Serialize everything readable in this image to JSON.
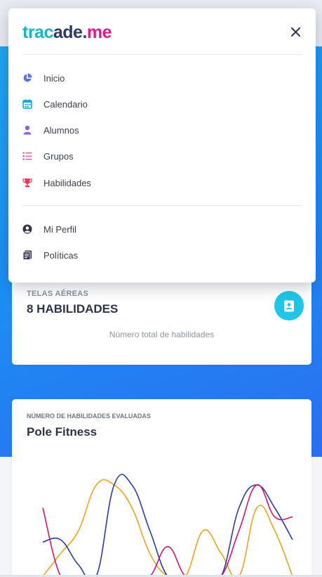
{
  "brand": {
    "logo_part1": "trac",
    "logo_part2": "ade.",
    "logo_part3": "me"
  },
  "menu": {
    "primary": [
      {
        "label": "Inicio",
        "icon": "pie-chart-icon",
        "color": "#5e72e4"
      },
      {
        "label": "Calendario",
        "icon": "calendar-icon",
        "color": "#11a8d8"
      },
      {
        "label": "Alumnos",
        "icon": "user-icon",
        "color": "#8965e0"
      },
      {
        "label": "Grupos",
        "icon": "list-icon",
        "color": "#f3449f"
      },
      {
        "label": "Habilidades",
        "icon": "trophy-icon",
        "color": "#f5365c"
      }
    ],
    "secondary": [
      {
        "label": "Mi Perfil",
        "icon": "user-circle-icon",
        "color": "#2e3447"
      },
      {
        "label": "Políticas",
        "icon": "document-icon",
        "color": "#2e3447"
      }
    ]
  },
  "cards": {
    "telas": {
      "category": "TELAS AÉREAS",
      "count": "8 HABILIDADES",
      "subtitle": "Número total de habilidades"
    },
    "pole": {
      "category": "NÚMERO DE HABILIDADES EVALUADAS",
      "title": "Pole Fitness"
    }
  },
  "colors": {
    "accent_cyan": "#1fc6e8",
    "gradient_start": "#1fa6f2",
    "gradient_end": "#2c6df0",
    "series_orange": "#f0a11f",
    "series_navy": "#2a3aa8",
    "series_magenta": "#d4146b"
  },
  "chart_data": {
    "type": "line",
    "series": [
      {
        "values": [
          0,
          1,
          2,
          4,
          4,
          3,
          1,
          0,
          0,
          2,
          1,
          0,
          3,
          2,
          0
        ]
      },
      {
        "values": [
          1.5,
          1.6,
          0.5,
          0,
          4,
          4,
          2,
          0,
          0,
          0,
          0,
          3,
          4,
          3,
          1.6
        ]
      },
      {
        "values": [
          3,
          0,
          0,
          0,
          0,
          0,
          0,
          1.3,
          0,
          0,
          0,
          2,
          4,
          2.6,
          2.6
        ]
      }
    ]
  }
}
